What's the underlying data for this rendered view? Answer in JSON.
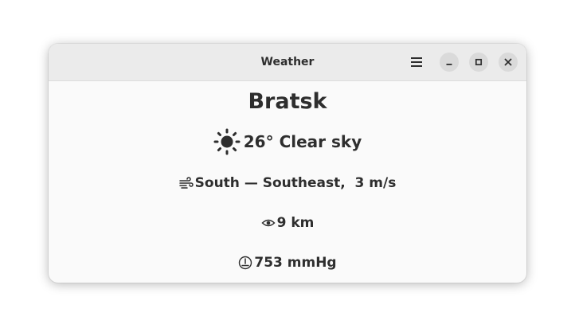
{
  "window": {
    "title": "Weather"
  },
  "weather": {
    "city": "Bratsk",
    "temperature": "26°",
    "condition": "Clear sky",
    "wind": "South — Southeast,  3 m/s",
    "visibility": "9 km",
    "pressure": "753 mmHg"
  },
  "icons": {
    "menu": "hamburger-menu-icon",
    "minimize": "minimize-icon",
    "maximize": "maximize-icon",
    "close": "close-icon",
    "condition": "sun-icon",
    "wind": "wind-icon",
    "visibility": "eye-icon",
    "pressure": "pressure-gauge-icon"
  },
  "colors": {
    "text": "#2e2e2e",
    "headerbar": "#ebebeb",
    "window_bg": "#fafafa",
    "button_bg": "#dadada"
  }
}
